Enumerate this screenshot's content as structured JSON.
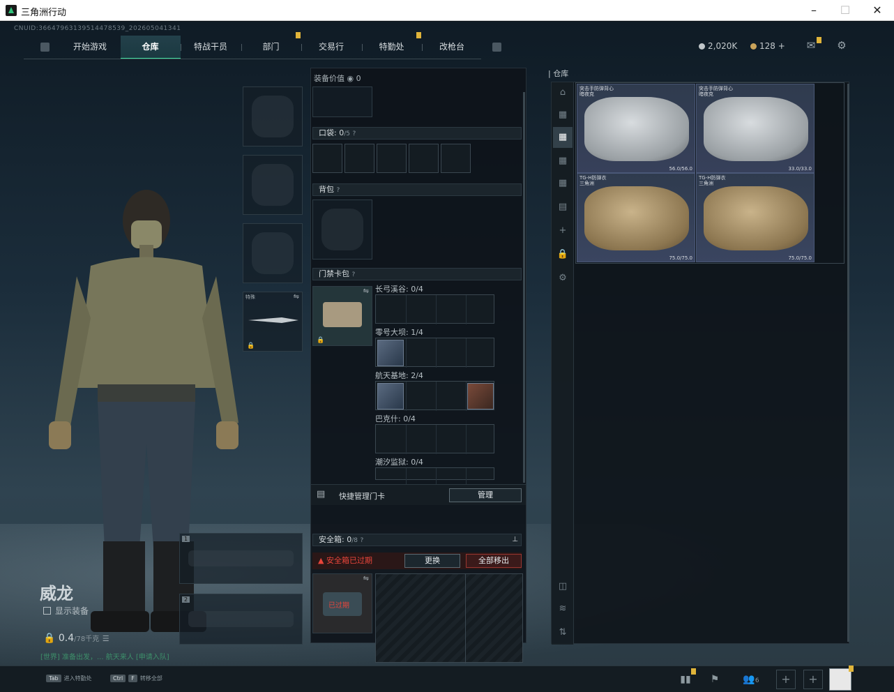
{
  "window": {
    "title": "三角洲行动"
  },
  "uid": "CNUID:36647963139514478539_202605041341",
  "nav": {
    "tabs": [
      {
        "label": "开始游戏",
        "active": false,
        "badge": false
      },
      {
        "label": "仓库",
        "active": true,
        "badge": false
      },
      {
        "label": "特战干员",
        "active": false,
        "badge": false
      },
      {
        "label": "部门",
        "active": false,
        "badge": true
      },
      {
        "label": "交易行",
        "active": false,
        "badge": false
      },
      {
        "label": "特勤处",
        "active": false,
        "badge": true
      },
      {
        "label": "改枪台",
        "active": false,
        "badge": false
      }
    ]
  },
  "currency": {
    "coins": "2,020K",
    "bonds": "128",
    "plus": "+"
  },
  "operator": {
    "name": "威龙",
    "show_equipment": "显示装备",
    "weight": "0.4",
    "weight_unit": "/78千克",
    "quote": "[世界] 准备出发，... 航天来人 [申请入队]"
  },
  "melee": {
    "label": "特殊"
  },
  "weapon_slots": [
    "1",
    "2"
  ],
  "equipment_panel": {
    "value_label": "装备价值",
    "value": "0",
    "pockets_label": "口袋:",
    "pockets_count": "0",
    "pockets_max": "/5",
    "backpack_label": "背包",
    "keycard_label": "门禁卡包",
    "help": "?",
    "maps": [
      {
        "name": "长弓溪谷:",
        "count": "0/4",
        "cards": []
      },
      {
        "name": "零号大坝:",
        "count": "1/4",
        "cards": [
          {
            "pos": 0,
            "red": false
          }
        ]
      },
      {
        "name": "航天基地:",
        "count": "2/4",
        "cards": [
          {
            "pos": 0,
            "red": false
          },
          {
            "pos": 3,
            "red": true
          }
        ]
      },
      {
        "name": "巴克什:",
        "count": "0/4",
        "cards": []
      },
      {
        "name": "潮汐监狱:",
        "count": "0/4",
        "cards": []
      }
    ],
    "quick_manage": "快捷管理门卡",
    "manage_btn": "管理",
    "safebox_label": "安全箱:",
    "safebox_count": "0",
    "safebox_max": "/8",
    "safebox_expired": "安全箱已过期",
    "replace_btn": "更换",
    "remove_all_btn": "全部移出",
    "expired_tag": "已过期"
  },
  "stash": {
    "label": "仓库",
    "items": [
      {
        "name": "突击手防弹背心",
        "sub": "暗夜克",
        "durability": "56.0/56.0",
        "color": "gray"
      },
      {
        "name": "突击手防弹背心",
        "sub": "暗夜克",
        "durability": "33.0/33.0",
        "color": "gray"
      },
      {
        "name": "TG-H防弹衣",
        "sub": "三角洲",
        "durability": "75.0/75.0",
        "color": "tan"
      },
      {
        "name": "TG-H防弹衣",
        "sub": "三角洲",
        "durability": "75.0/75.0",
        "color": "tan"
      }
    ]
  },
  "footer": {
    "hint1_key": "Tab",
    "hint1": "进入特勤处",
    "hint2_key1": "Ctrl",
    "hint2_key2": "F",
    "hint2": "转移全部",
    "friends": "6"
  }
}
